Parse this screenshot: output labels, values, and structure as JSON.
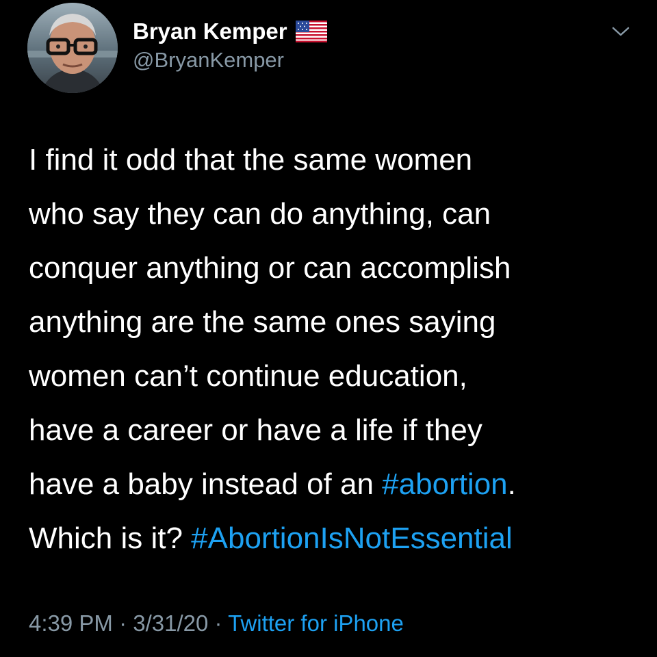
{
  "user": {
    "display_name": "Bryan Kemper",
    "handle": "@BryanKemper",
    "verified_flag_icon": "us-flag-icon",
    "avatar_icon": "profile-photo"
  },
  "caret_icon": "chevron-down-icon",
  "tweet": {
    "line1": "I find it odd that the same women",
    "line2": "who say they can do anything, can",
    "line3": "conquer anything or can accomplish",
    "line4": "anything are the same ones saying",
    "line5": "women can’t continue education,",
    "line6": "have a career or have a life if they",
    "line7_text": "have a baby instead of an ",
    "line7_hashtag": "#abortion",
    "line7_end": ".",
    "line8_text": "Which is it? ",
    "line8_hashtag": "#AbortionIsNotEssential"
  },
  "meta": {
    "time": "4:39 PM",
    "separator1": " · ",
    "date": "3/31/20",
    "separator2": " · ",
    "source": "Twitter for iPhone"
  },
  "colors": {
    "background": "#000000",
    "text": "#ffffff",
    "secondary": "#8899a6",
    "link": "#1da1f2"
  }
}
